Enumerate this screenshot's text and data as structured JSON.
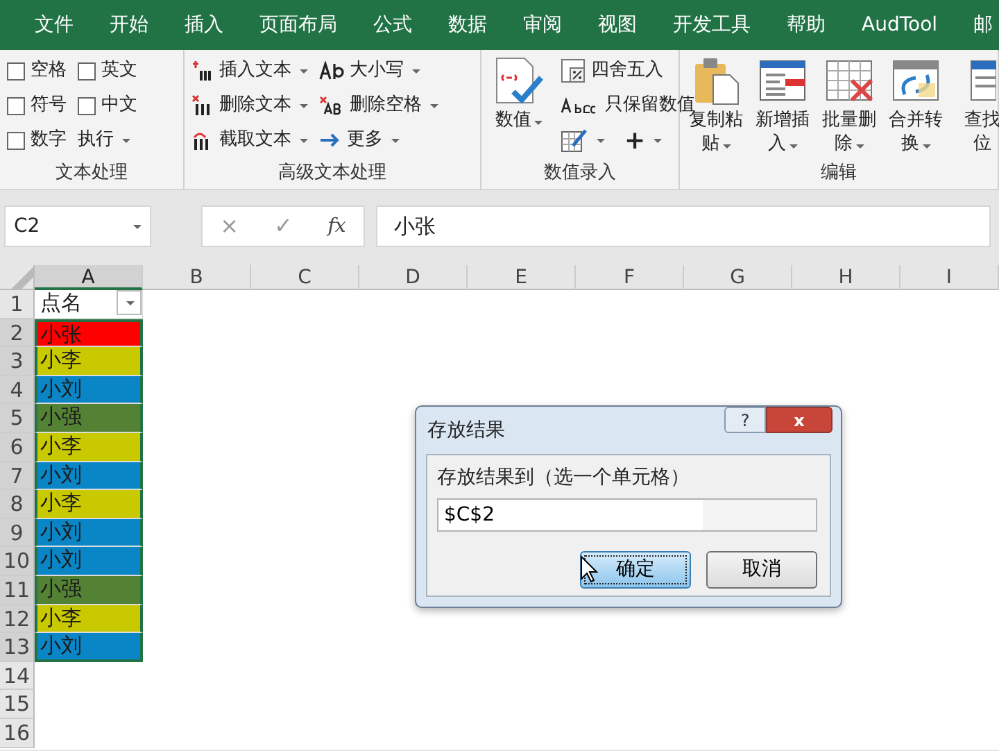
{
  "menu_tabs": [
    "文件",
    "开始",
    "插入",
    "页面布局",
    "公式",
    "数据",
    "审阅",
    "视图",
    "开发工具",
    "帮助",
    "AudTool",
    "邮"
  ],
  "ribbon": {
    "groups": [
      {
        "label": "文本处理",
        "columns": [
          [
            [
              {
                "kind": "checkbox",
                "label": "空格",
                "checked": false
              }
            ],
            [
              {
                "kind": "checkbox",
                "label": "符号",
                "checked": false
              }
            ],
            [
              {
                "kind": "checkbox",
                "label": "数字",
                "checked": false
              }
            ]
          ],
          [
            [
              {
                "kind": "checkbox",
                "label": "英文",
                "checked": false
              }
            ],
            [
              {
                "kind": "checkbox",
                "label": "中文",
                "checked": false
              }
            ],
            [
              {
                "kind": "small",
                "label": "执行",
                "dropdown": true
              }
            ]
          ]
        ]
      },
      {
        "label": "高级文本处理",
        "columns": [
          [
            [
              {
                "kind": "small",
                "label": "插入文本",
                "dropdown": true
              }
            ],
            [
              {
                "kind": "small",
                "label": "删除文本",
                "dropdown": true
              }
            ],
            [
              {
                "kind": "small",
                "label": "截取文本",
                "dropdown": true
              }
            ]
          ],
          [
            [
              {
                "kind": "small",
                "label": "大小写",
                "dropdown": true
              }
            ],
            [
              {
                "kind": "small",
                "label": "删除空格",
                "dropdown": true
              }
            ],
            [
              {
                "kind": "small",
                "label": "更多",
                "dropdown": true
              }
            ]
          ]
        ]
      },
      {
        "label": "数值录入",
        "columns": [
          [
            [
              {
                "kind": "large",
                "lines": [
                  "数值"
                ],
                "dropdown": true
              }
            ]
          ],
          [
            [
              {
                "kind": "small",
                "label": "四舍五入",
                "dropdown": false
              }
            ],
            [
              {
                "kind": "small",
                "label": "只保留数值",
                "dropdown": false
              }
            ],
            [
              {
                "kind": "icon",
                "dropdown": true
              },
              {
                "kind": "text",
                "label": "+",
                "dropdown": true
              }
            ]
          ]
        ]
      },
      {
        "label": "编辑",
        "columns": [
          [
            [
              {
                "kind": "large",
                "lines": [
                  "复制粘",
                  "贴"
                ],
                "dropdown": true
              }
            ]
          ],
          [
            [
              {
                "kind": "large",
                "lines": [
                  "新增插",
                  "入"
                ],
                "dropdown": true
              }
            ]
          ],
          [
            [
              {
                "kind": "large",
                "lines": [
                  "批量删",
                  "除"
                ],
                "dropdown": true
              }
            ]
          ],
          [
            [
              {
                "kind": "large",
                "lines": [
                  "合并转",
                  "换"
                ],
                "dropdown": true
              }
            ]
          ],
          [
            [
              {
                "kind": "large",
                "lines": [
                  "查找",
                  "位"
                ],
                "dropdown": false
              }
            ]
          ]
        ]
      }
    ]
  },
  "formula_bar": {
    "name_box": "C2",
    "cancel": "×",
    "enter": "✓",
    "function": "fx",
    "value": "小张"
  },
  "sheet": {
    "columns": [
      {
        "label": "A",
        "selected": true
      },
      {
        "label": "B",
        "selected": false
      },
      {
        "label": "C",
        "selected": false
      },
      {
        "label": "D",
        "selected": false
      },
      {
        "label": "E",
        "selected": false
      },
      {
        "label": "F",
        "selected": false
      },
      {
        "label": "G",
        "selected": false
      },
      {
        "label": "H",
        "selected": false
      },
      {
        "label": "I",
        "selected": false
      }
    ],
    "rows": [
      {
        "number": "1",
        "selected": false,
        "cell_a": {
          "text": "点名",
          "filter": true
        }
      },
      {
        "number": "2",
        "selected": true,
        "cell_a": {
          "text": "小张",
          "color": "#ff0000",
          "filter": false
        }
      },
      {
        "number": "3",
        "selected": true,
        "cell_a": {
          "text": "小李",
          "color": "#c9c900",
          "filter": false
        }
      },
      {
        "number": "4",
        "selected": true,
        "cell_a": {
          "text": "小刘",
          "color": "#0a86c6",
          "filter": false
        }
      },
      {
        "number": "5",
        "selected": true,
        "cell_a": {
          "text": "小强",
          "color": "#548235",
          "filter": false
        }
      },
      {
        "number": "6",
        "selected": true,
        "cell_a": {
          "text": "小李",
          "color": "#c9c900",
          "filter": false
        }
      },
      {
        "number": "7",
        "selected": true,
        "cell_a": {
          "text": "小刘",
          "color": "#0a86c6",
          "filter": false
        }
      },
      {
        "number": "8",
        "selected": true,
        "cell_a": {
          "text": "小李",
          "color": "#c9c900",
          "filter": false
        }
      },
      {
        "number": "9",
        "selected": true,
        "cell_a": {
          "text": "小刘",
          "color": "#0a86c6",
          "filter": false
        }
      },
      {
        "number": "10",
        "selected": true,
        "cell_a": {
          "text": "小刘",
          "color": "#0a86c6",
          "filter": false
        }
      },
      {
        "number": "11",
        "selected": true,
        "cell_a": {
          "text": "小强",
          "color": "#548235",
          "filter": false
        }
      },
      {
        "number": "12",
        "selected": true,
        "cell_a": {
          "text": "小李",
          "color": "#c9c900",
          "filter": false
        }
      },
      {
        "number": "13",
        "selected": true,
        "cell_a": {
          "text": "小刘",
          "color": "#0a86c6",
          "filter": false
        }
      },
      {
        "number": "14",
        "selected": false
      },
      {
        "number": "15",
        "selected": false
      },
      {
        "number": "16",
        "selected": false
      }
    ]
  },
  "dialog": {
    "title": "存放结果",
    "help": "?",
    "close": "x",
    "field_label": "存放结果到（选一个单元格）",
    "field_value": "$C$2",
    "buttons": [
      {
        "label": "确定",
        "focused": true
      },
      {
        "label": "取消",
        "focused": false
      }
    ]
  }
}
